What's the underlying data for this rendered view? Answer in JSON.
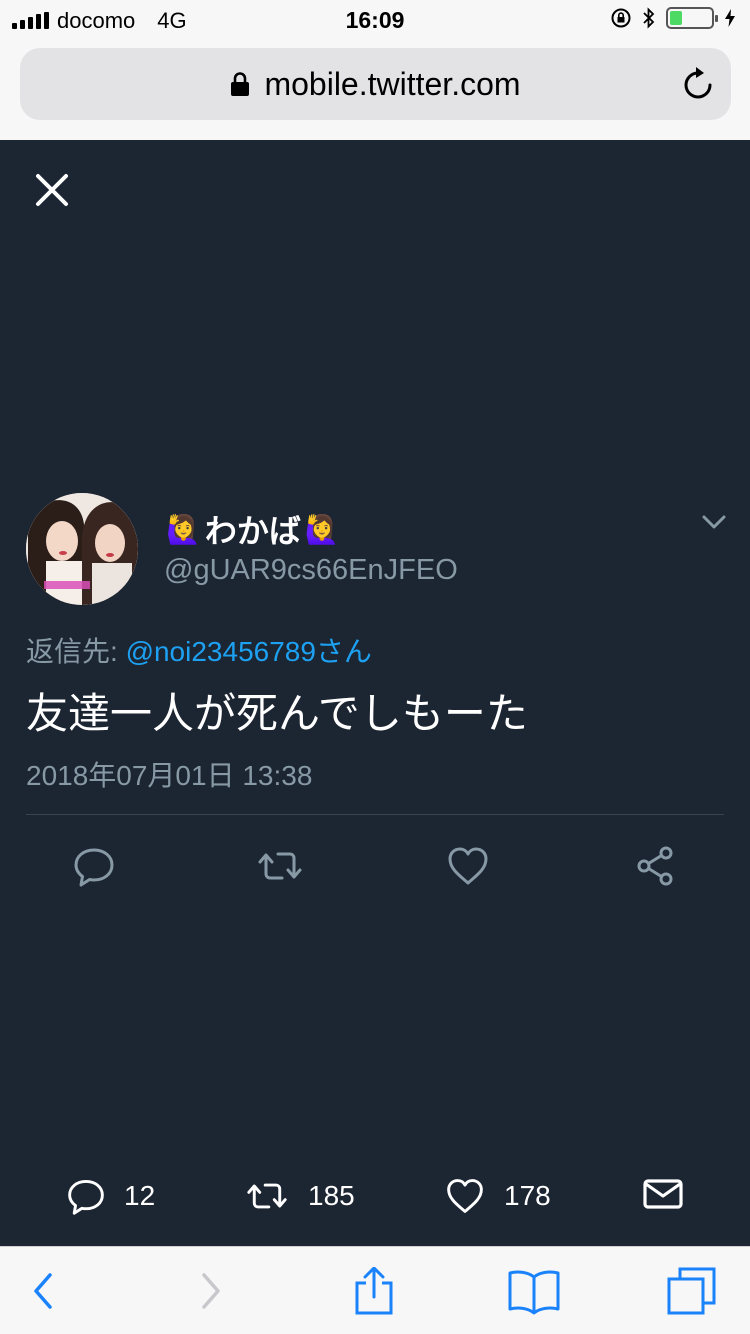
{
  "status_bar": {
    "carrier": "docomo",
    "network": "4G",
    "time": "16:09",
    "battery_level": 0.3,
    "battery_color": "#4cd964"
  },
  "browser": {
    "url": "mobile.twitter.com",
    "icons": [
      "lock-icon",
      "reload-icon"
    ]
  },
  "tweet": {
    "author_name": "わかば",
    "name_emoji": "🙋‍♀️",
    "handle": "@gUAR9cs66EnJFEO",
    "reply_prefix": "返信先: ",
    "reply_to": "@noi23456789さん",
    "text": "友達一人が死んでしもーた",
    "timestamp": "2018年07月01日 13:38",
    "actions": [
      "reply-icon",
      "retweet-icon",
      "like-icon",
      "share-icon"
    ]
  },
  "stats": {
    "replies": "12",
    "retweets": "185",
    "likes": "178"
  },
  "colors": {
    "background": "#1c2532",
    "link": "#1da1f2",
    "secondary_text": "#8899a6",
    "toolbar_tint": "#1a82fb"
  },
  "toolbar": {
    "icons": [
      "back-icon",
      "forward-icon",
      "share-icon",
      "bookmarks-icon",
      "tabs-icon"
    ]
  }
}
